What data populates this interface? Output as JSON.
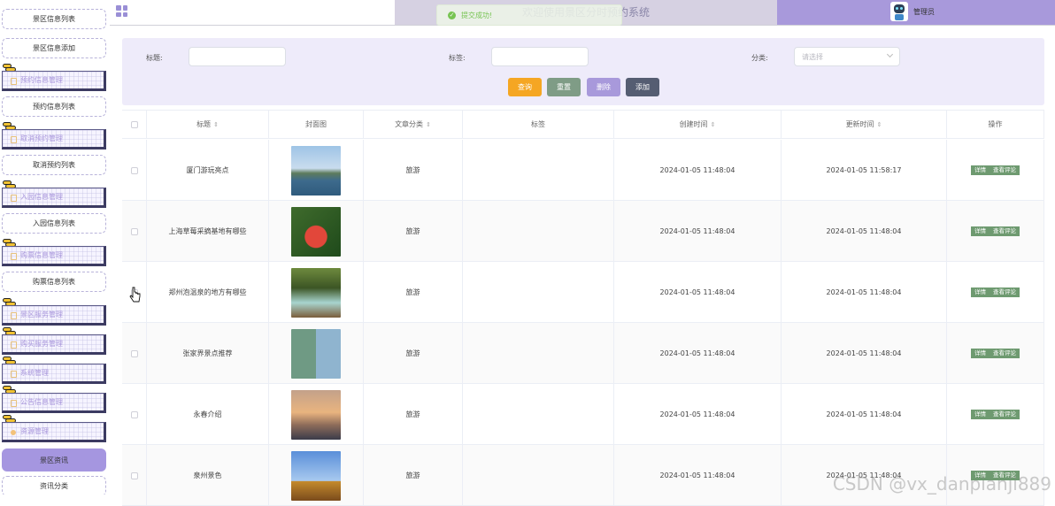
{
  "header": {
    "welcome": "欢迎使用景区分时预约系统",
    "toast": "提交成功!",
    "user_role": "管理员"
  },
  "sidebar": {
    "items": [
      {
        "label": "景区信息列表",
        "type": "sub"
      },
      {
        "label": "景区信息添加",
        "type": "sub"
      },
      {
        "label": "预约信息管理",
        "type": "menu"
      },
      {
        "label": "预约信息列表",
        "type": "sub"
      },
      {
        "label": "取消预约管理",
        "type": "menu"
      },
      {
        "label": "取消预约列表",
        "type": "sub"
      },
      {
        "label": "入园信息管理",
        "type": "menu"
      },
      {
        "label": "入园信息列表",
        "type": "sub"
      },
      {
        "label": "购票信息管理",
        "type": "menu"
      },
      {
        "label": "购票信息列表",
        "type": "sub"
      },
      {
        "label": "景区服务管理",
        "type": "menu"
      },
      {
        "label": "购买服务管理",
        "type": "menu"
      },
      {
        "label": "系统管理",
        "type": "menu"
      },
      {
        "label": "公告信息管理",
        "type": "menu"
      },
      {
        "label": "资源管理",
        "type": "menu"
      },
      {
        "label": "景区资讯",
        "type": "active"
      },
      {
        "label": "资讯分类",
        "type": "sub"
      }
    ]
  },
  "search": {
    "title_label": "标题:",
    "tag_label": "标签:",
    "category_label": "分类:",
    "category_placeholder": "请选择",
    "title_value": "",
    "tag_value": ""
  },
  "buttons": {
    "query": "查询",
    "reset": "重置",
    "delete": "删除",
    "add": "添加"
  },
  "colors": {
    "query": "#f5a623",
    "reset": "#7f9c86",
    "delete": "#a899db",
    "add": "#555d72",
    "accent": "#a899db"
  },
  "table": {
    "columns": [
      "标题",
      "封面图",
      "文章分类",
      "标签",
      "创建时间",
      "更新时间",
      "操作"
    ],
    "actions": {
      "detail": "详情",
      "comments": "查看评论"
    },
    "rows": [
      {
        "title": "厦门游玩亮点",
        "category": "旅游",
        "tag": "",
        "created": "2024-01-05 11:48:04",
        "updated": "2024-01-05 11:58:17"
      },
      {
        "title": "上海草莓采摘基地有哪些",
        "category": "旅游",
        "tag": "",
        "created": "2024-01-05 11:48:04",
        "updated": "2024-01-05 11:48:04"
      },
      {
        "title": "郑州泡温泉的地方有哪些",
        "category": "旅游",
        "tag": "",
        "created": "2024-01-05 11:48:04",
        "updated": "2024-01-05 11:48:04"
      },
      {
        "title": "张家界景点推荐",
        "category": "旅游",
        "tag": "",
        "created": "2024-01-05 11:48:04",
        "updated": "2024-01-05 11:48:04"
      },
      {
        "title": "永春介绍",
        "category": "旅游",
        "tag": "",
        "created": "2024-01-05 11:48:04",
        "updated": "2024-01-05 11:48:04"
      },
      {
        "title": "泉州景色",
        "category": "旅游",
        "tag": "",
        "created": "2024-01-05 11:48:04",
        "updated": "2024-01-05 11:48:04"
      }
    ]
  },
  "watermark": "CSDN @vx_danpianji889"
}
